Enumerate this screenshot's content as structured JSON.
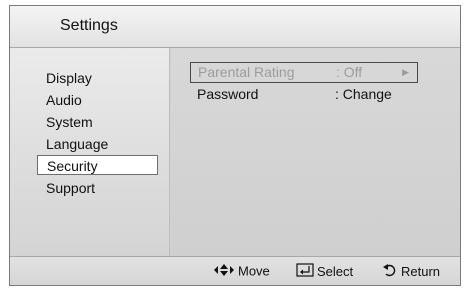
{
  "title": "Settings",
  "sidebar": {
    "items": [
      {
        "label": "Display"
      },
      {
        "label": "Audio"
      },
      {
        "label": "System"
      },
      {
        "label": "Language"
      },
      {
        "label": "Security",
        "selected": true
      },
      {
        "label": "Support"
      }
    ]
  },
  "options": [
    {
      "label": "Parental Rating",
      "value": ": Off",
      "arrow": "right-triangle-icon",
      "highlighted": true,
      "disabled": true
    },
    {
      "label": "Password",
      "value": ": Change"
    }
  ],
  "footer": {
    "move_label": "Move",
    "select_label": "Select",
    "return_label": "Return",
    "icons": [
      "direction-arrows-icon",
      "enter-icon",
      "return-icon"
    ]
  },
  "colors": {
    "background": "#d2d2d2",
    "title_bar": "#e8e8e8",
    "disabled_text": "#9c9c9c",
    "selected_bg": "#ffffff"
  }
}
